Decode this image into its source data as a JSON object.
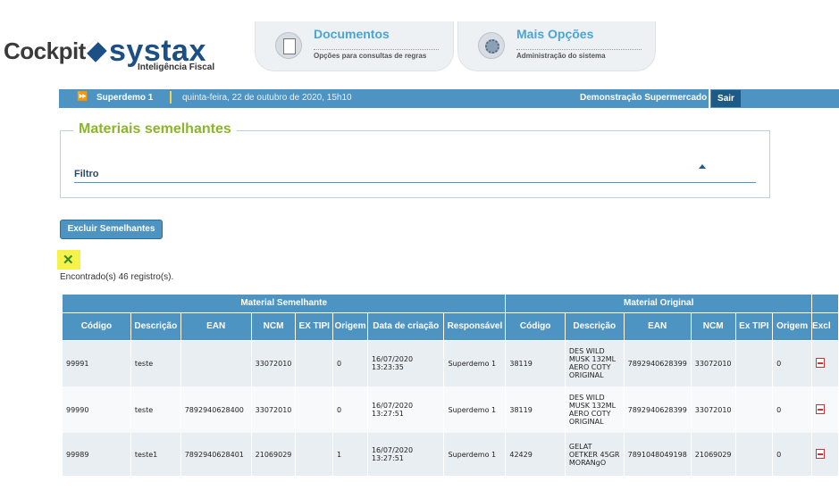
{
  "logo": {
    "cockpit": "Cockpit",
    "systax": "systax",
    "tagline": "Inteligência Fiscal"
  },
  "menu": [
    {
      "title": "Documentos",
      "subtitle": "Opções para consultas de regras"
    },
    {
      "title": "Mais Opções",
      "subtitle": "Administração do sistema"
    }
  ],
  "bar": {
    "arrow": "⏩",
    "user": "Superdemo 1",
    "date": "quinta-feira, 22 de outubro de 2020, 15h10",
    "store": "Demonstração Supermercado",
    "logout": "Sair"
  },
  "section": {
    "title": "Materiais semelhantes",
    "filter_label": "Filtro"
  },
  "actions": {
    "delete_label": "Excluir Semelhantes",
    "excel_icon": "excel-icon"
  },
  "found_text": "Encontrado(s) 46 registro(s).",
  "table": {
    "group_headers": [
      "Material Semelhante",
      "Material Original",
      ""
    ],
    "columns": [
      "Código",
      "Descrição",
      "EAN",
      "NCM",
      "EX TIPI",
      "Origem",
      "Data de criação",
      "Responsável",
      "Código",
      "Descrição",
      "EAN",
      "NCM",
      "Ex TIPI",
      "Origem",
      "Excl"
    ],
    "rows": [
      [
        "99991",
        "teste",
        "",
        "33072010",
        "",
        "0",
        "16/07/2020 13:23:35",
        "Superdemo 1",
        "38119",
        "DES WILD MUSK 132ML AERO COTY ORIGINAL",
        "7892940628399",
        "33072010",
        "",
        "0"
      ],
      [
        "99990",
        "teste",
        "7892940628400",
        "33072010",
        "",
        "0",
        "16/07/2020 13:27:51",
        "Superdemo 1",
        "38119",
        "DES WILD MUSK 132ML AERO COTY ORIGINAL",
        "7892940628399",
        "33072010",
        "",
        "0"
      ],
      [
        "99989",
        "teste1",
        "7892940628401",
        "21069029",
        "",
        "1",
        "16/07/2020 13:27:51",
        "Superdemo 1",
        "42429",
        "GELAT OETKER 45GR MORANgO",
        "7891048049198",
        "21069029",
        "",
        "0"
      ]
    ]
  }
}
